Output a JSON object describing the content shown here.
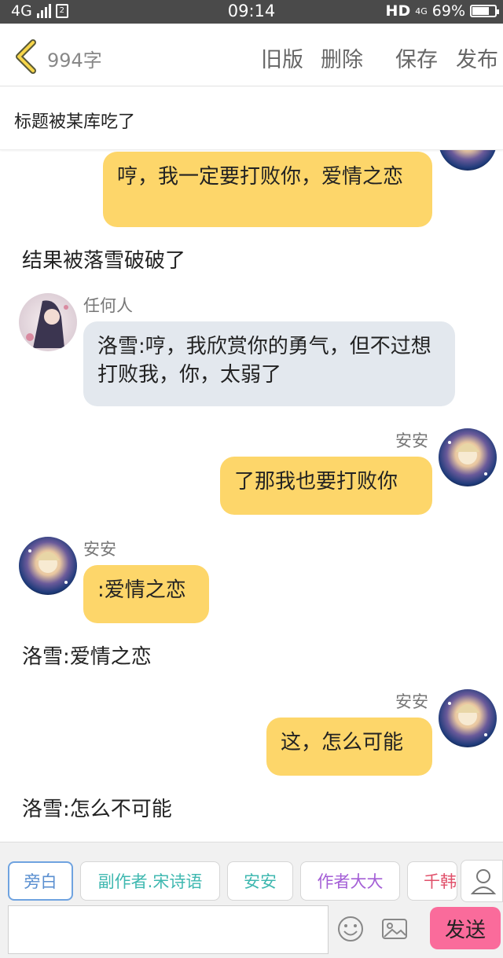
{
  "status_bar": {
    "network": "4G",
    "time": "09:14",
    "hd": "HD",
    "hd_network": "4G",
    "battery": "69%",
    "battery_level": 0.69
  },
  "toolbar": {
    "back_icon": "chevron-left-icon",
    "word_count": "994字",
    "old_version": "旧版",
    "delete": "删除",
    "save": "保存",
    "publish": "发布"
  },
  "title": "标题被某库吃了",
  "messages": [
    {
      "type": "right",
      "text": "哼，我一定要打败你，爱情之恋"
    },
    {
      "type": "narration",
      "text": "结果被落雪破破了"
    },
    {
      "type": "left",
      "speaker": "任何人",
      "text": "洛雪:哼，我欣赏你的勇气，但不过想打败我，你，太弱了"
    },
    {
      "type": "right",
      "speaker": "安安",
      "text": "了那我也要打败你"
    },
    {
      "type": "left",
      "speaker": "安安",
      "text": ":爱情之恋"
    },
    {
      "type": "narration",
      "text": "洛雪:爱情之恋"
    },
    {
      "type": "right",
      "speaker": "安安",
      "text": "这，怎么可能"
    },
    {
      "type": "narration",
      "text": "洛雪:怎么不可能"
    }
  ],
  "roles": [
    {
      "label": "旁白",
      "color": "#5a8fd0",
      "active": true
    },
    {
      "label": "副作者.宋诗语",
      "color": "#3fb8b0"
    },
    {
      "label": "安安",
      "color": "#3fb8b0"
    },
    {
      "label": "作者大大",
      "color": "#a45fd6"
    },
    {
      "label": "千韩",
      "color": "#e0506a"
    }
  ],
  "input": {
    "placeholder": ""
  },
  "icons": {
    "person": "person-icon",
    "emoji": "emoji-icon",
    "image": "image-icon"
  },
  "send_label": "发送"
}
